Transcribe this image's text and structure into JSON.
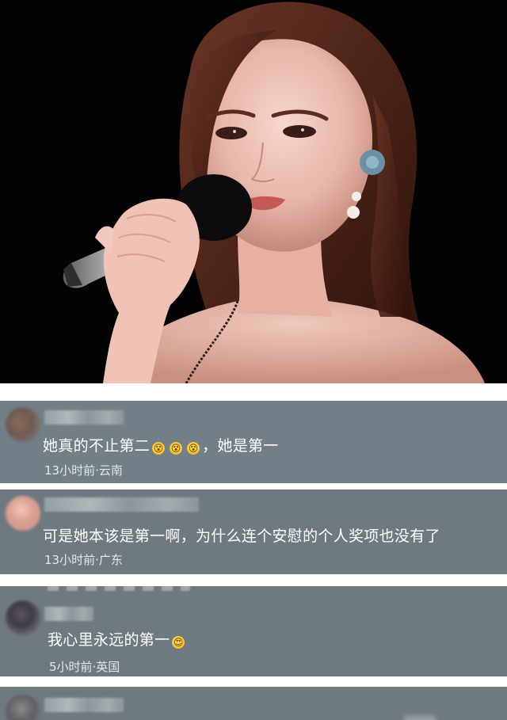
{
  "photo": {
    "icon": "singer-with-microphone-photo"
  },
  "comments": [
    {
      "username": "",
      "text_before": "她真的不止第二",
      "emojis": [
        "😵",
        "😵",
        "😵"
      ],
      "text_after": "，她是第一",
      "time": "13小时前",
      "location": "云南",
      "meta": "13小时前·云南"
    },
    {
      "username": "",
      "text": "可是她本该是第一啊，为什么连个安慰的个人奖项也没有了",
      "time": "13小时前",
      "location": "广东",
      "meta": "13小时前·广东"
    },
    {
      "username": "",
      "text": "我心里永远的第一",
      "emojis": [
        "😍"
      ],
      "time": "5小时前",
      "location": "英国",
      "meta": "5小时前·英国"
    },
    {
      "username": ""
    }
  ],
  "colors": {
    "panel_bg": "#6e7a80",
    "text": "#ffffff",
    "meta_text": "#e3e8ea",
    "photo_bg": "#030303"
  }
}
